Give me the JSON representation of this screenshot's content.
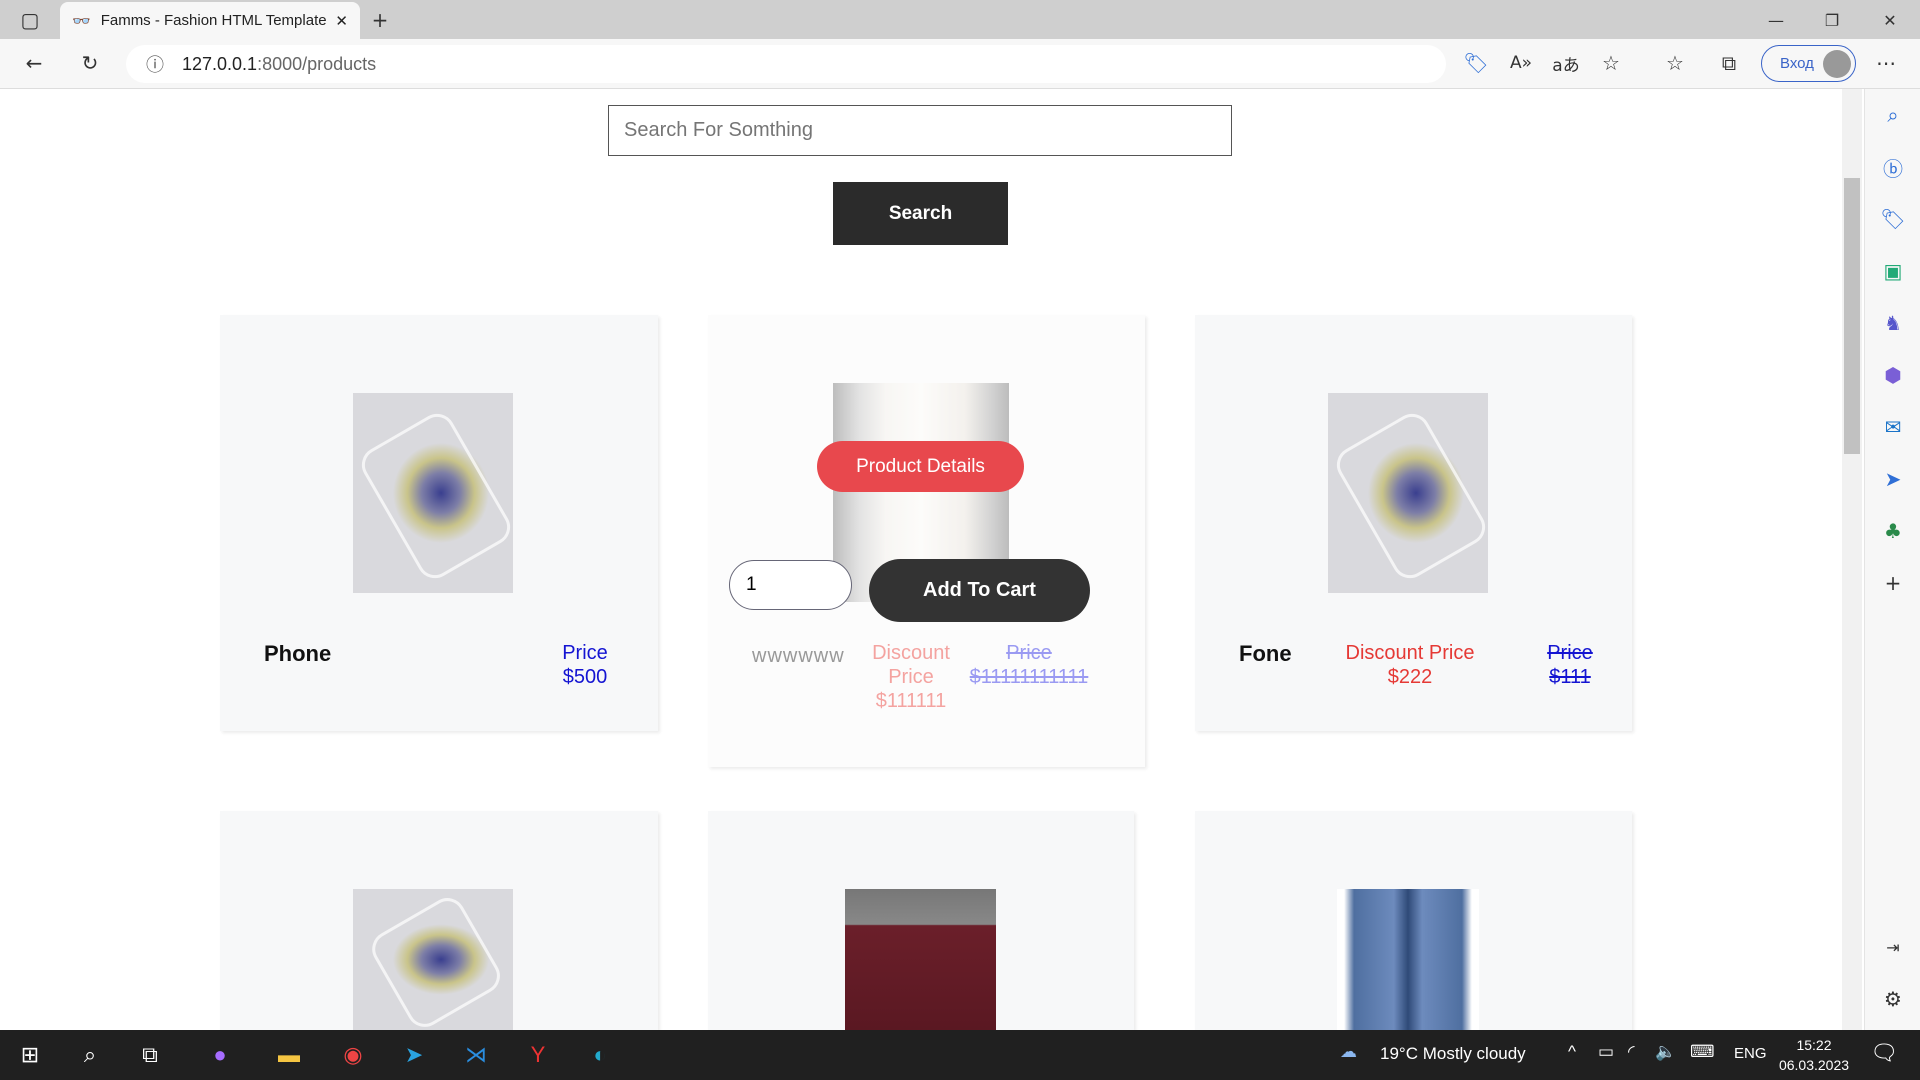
{
  "browser": {
    "tab_title": "Famms - Fashion HTML Template",
    "url_host": "127.0.0.1",
    "url_rest": ":8000/products",
    "login_label": "Вход"
  },
  "search": {
    "placeholder": "Search For Somthing",
    "button_label": "Search"
  },
  "products": [
    {
      "name": "Phone",
      "price_label": "Price",
      "price": "$500"
    },
    {
      "name": "wwwwww",
      "discount_label": "Discount Price",
      "discount_price": "$111111",
      "price_label": "Price",
      "price": "$11111111111",
      "details_label": "Product Details",
      "quantity": "1",
      "add_to_cart_label": "Add To Cart"
    },
    {
      "name": "Fone",
      "discount_label": "Discount Price",
      "discount_price": "$222",
      "price_label": "Price",
      "price": "$111"
    }
  ],
  "colors": {
    "discount": "#e53935",
    "price": "#1414d2",
    "button_dark": "#2b2b2b",
    "details_button": "#e8484d"
  },
  "taskbar": {
    "weather": "19°C  Mostly cloudy",
    "lang": "ENG",
    "time": "15:22",
    "date": "06.03.2023"
  }
}
